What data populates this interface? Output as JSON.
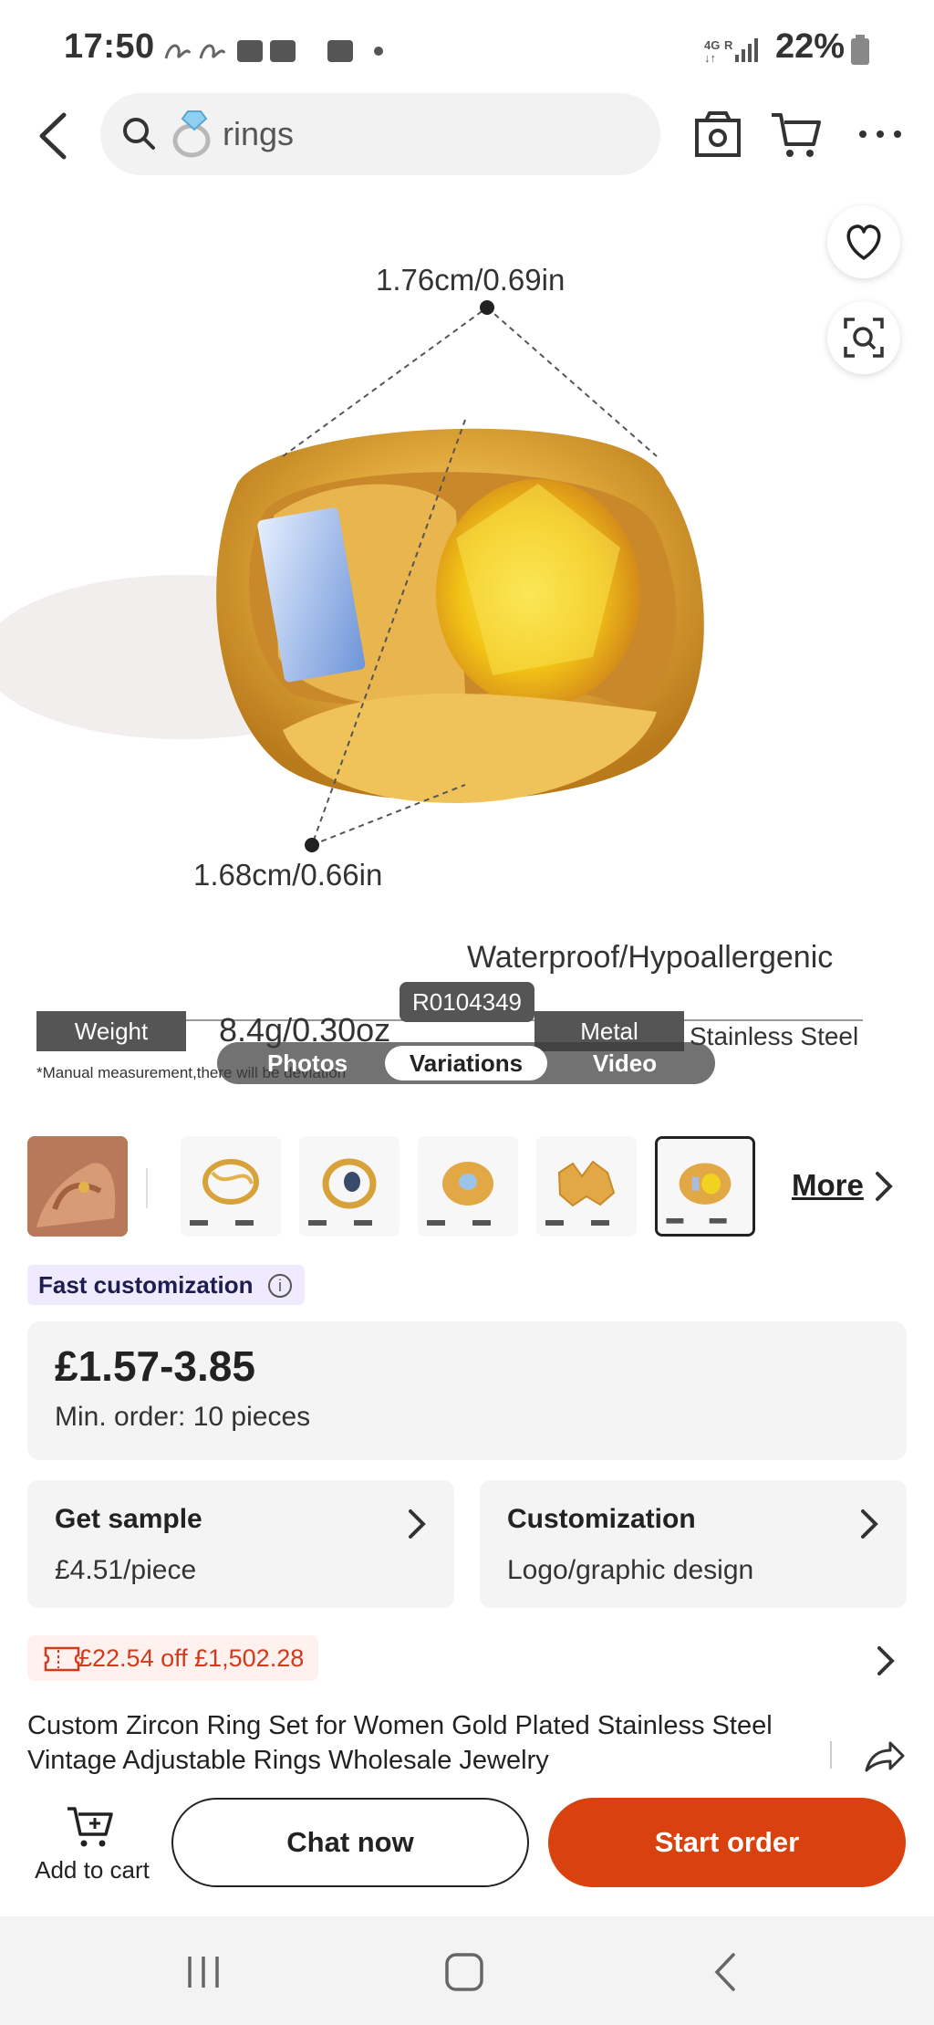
{
  "status": {
    "time": "17:50",
    "battery": "22%",
    "network": "4G",
    "roaming": "R"
  },
  "header": {
    "search_text": "rings"
  },
  "gallery": {
    "dim_top": "1.76cm/0.69in",
    "dim_bottom": "1.68cm/0.66in",
    "tagline": "Waterproof/Hypoallergenic",
    "weight_label": "Weight",
    "weight_value": "8.4g/0.30oz",
    "metal_label": "Metal",
    "metal_value": "Stainless Steel",
    "manual_note": "*Manual measurement,there will be deviation",
    "code": "R0104349",
    "tabs": [
      "Photos",
      "Variations",
      "Video"
    ],
    "active_tab": "Variations"
  },
  "thumbnails": {
    "more_label": "More"
  },
  "badge": {
    "label": "Fast customization"
  },
  "price": {
    "range": "£1.57-3.85",
    "min_order": "Min. order: 10 pieces"
  },
  "cards": [
    {
      "title": "Get sample",
      "subtitle": "£4.51/piece"
    },
    {
      "title": "Customization",
      "subtitle": "Logo/graphic design"
    }
  ],
  "coupon": {
    "text": "£22.54 off £1,502.28"
  },
  "product_title": "Custom Zircon Ring Set for Women Gold Plated Stainless Steel Vintage Adjustable Rings Wholesale Jewelry",
  "actions": {
    "add_to_cart": "Add to cart",
    "chat": "Chat now",
    "start_order": "Start order"
  },
  "colors": {
    "accent": "#d9410f",
    "coupon_text": "#d23a1c",
    "badge_bg": "#f0eaff"
  }
}
